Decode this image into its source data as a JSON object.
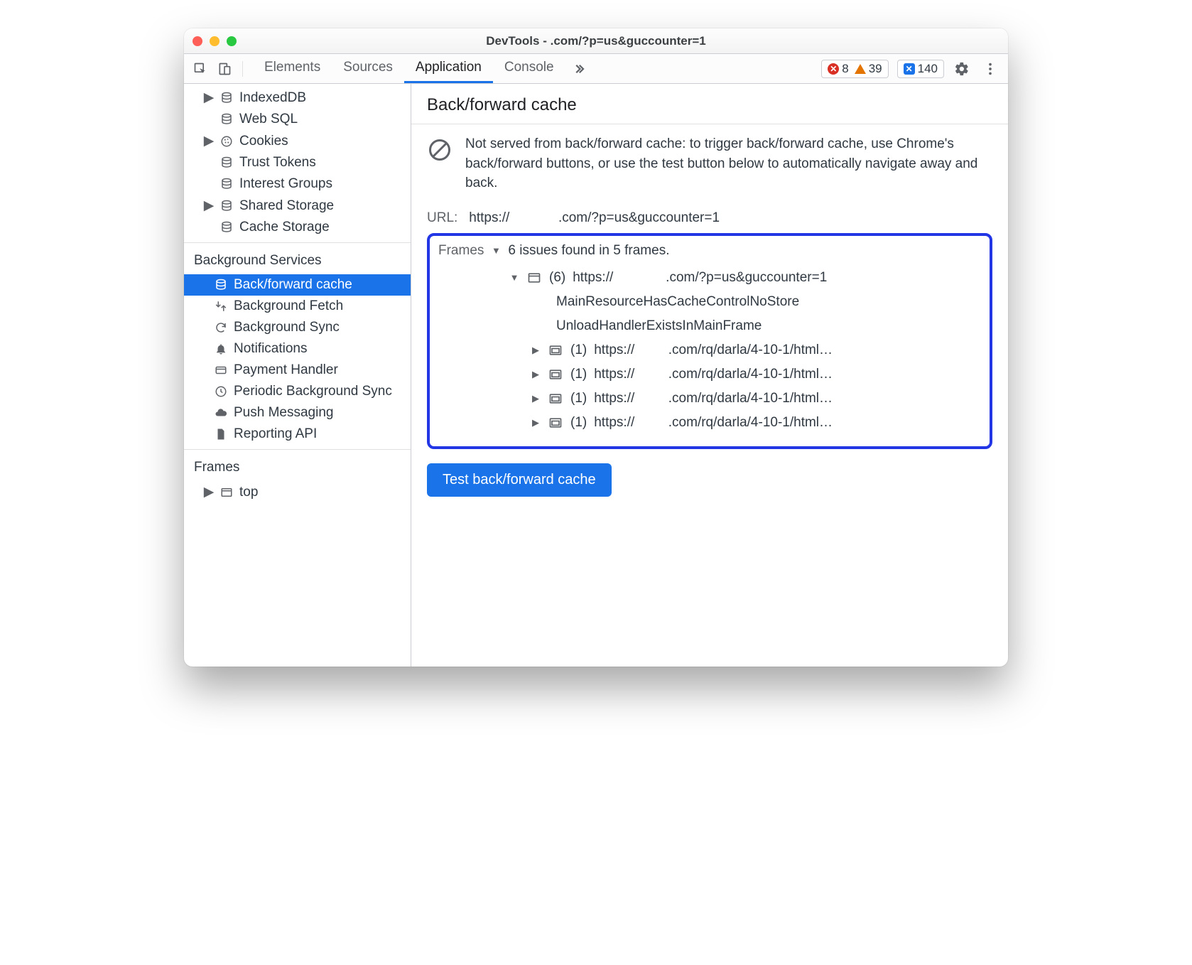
{
  "title": "DevTools -            .com/?p=us&guccounter=1",
  "tabs": {
    "elements": "Elements",
    "sources": "Sources",
    "application": "Application",
    "console": "Console"
  },
  "counters": {
    "errors": "8",
    "warnings": "39",
    "issues": "140"
  },
  "sidebar": {
    "storage_items": [
      {
        "label": "IndexedDB",
        "has_children": true
      },
      {
        "label": "Web SQL",
        "has_children": false
      },
      {
        "label": "Cookies",
        "has_children": true
      },
      {
        "label": "Trust Tokens",
        "has_children": false
      },
      {
        "label": "Interest Groups",
        "has_children": false
      },
      {
        "label": "Shared Storage",
        "has_children": true
      },
      {
        "label": "Cache Storage",
        "has_children": false
      }
    ],
    "bg_section": "Background Services",
    "bg_items": [
      {
        "label": "Back/forward cache"
      },
      {
        "label": "Background Fetch"
      },
      {
        "label": "Background Sync"
      },
      {
        "label": "Notifications"
      },
      {
        "label": "Payment Handler"
      },
      {
        "label": "Periodic Background Sync"
      },
      {
        "label": "Push Messaging"
      },
      {
        "label": "Reporting API"
      }
    ],
    "frames_section": "Frames",
    "frames_top": "top"
  },
  "panel": {
    "heading": "Back/forward cache",
    "notice": "Not served from back/forward cache: to trigger back/forward cache, use Chrome's back/forward buttons, or use the test button below to automatically navigate away and back.",
    "url_label": "URL:",
    "url_value": "https://             .com/?p=us&guccounter=1",
    "frames_label": "Frames",
    "frames_summary": "6 issues found in 5 frames.",
    "top_frame_count": "(6)",
    "top_frame_url": "https://              .com/?p=us&guccounter=1",
    "reasons": [
      "MainResourceHasCacheControlNoStore",
      "UnloadHandlerExistsInMainFrame"
    ],
    "child_frames": [
      {
        "count": "(1)",
        "url": "https://         .com/rq/darla/4-10-1/html…"
      },
      {
        "count": "(1)",
        "url": "https://         .com/rq/darla/4-10-1/html…"
      },
      {
        "count": "(1)",
        "url": "https://         .com/rq/darla/4-10-1/html…"
      },
      {
        "count": "(1)",
        "url": "https://         .com/rq/darla/4-10-1/html…"
      }
    ],
    "test_button": "Test back/forward cache"
  }
}
